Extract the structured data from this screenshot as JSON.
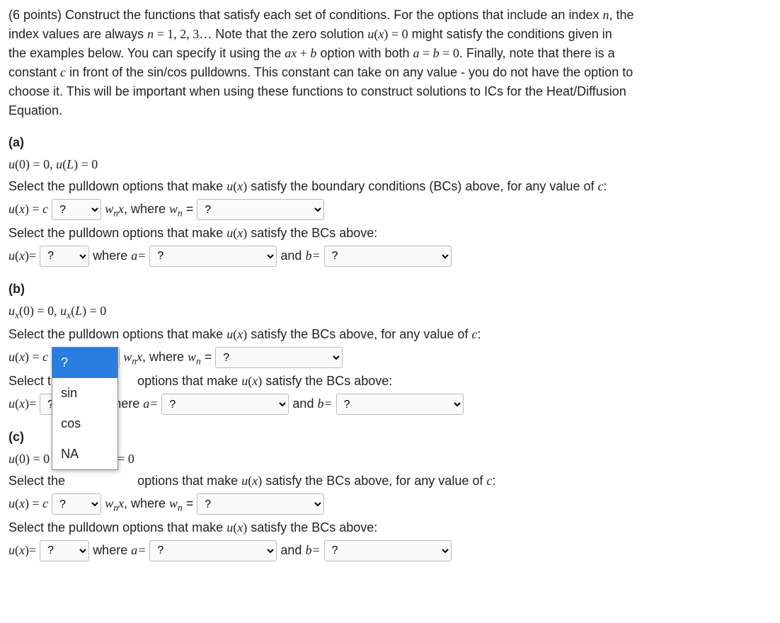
{
  "intro": {
    "line1_a": "(6 points) Construct the functions that satisfy each set of conditions. For the options that include an index ",
    "line1_b": ", the",
    "line2_a": "index values are always ",
    "line2_b": " Note that the zero solution ",
    "line2_c": " might satisfy the conditions given in",
    "line3_a": "the examples below. You can specify it using the ",
    "line3_b": " option with both ",
    "line3_c": ". Finally, note that there is a",
    "line4_a": "constant ",
    "line4_b": " in front of the sin/cos pulldowns. This constant can take on any value - you do not have the option to",
    "line5": "choose it. This will be important when using these functions to construct solutions to ICs for the Heat/Diffusion",
    "line6": "Equation.",
    "n_eq": "n = 1, 2, 3…",
    "ux0": "u(x) = 0",
    "axb": "ax + b",
    "ab0": "a = b = 0",
    "n": "n",
    "c": "c"
  },
  "common": {
    "select_any_c": "Select the pulldown options that make ",
    "satisfy_bc_anyc": " satisfy the boundary conditions (BCs) above, for any value of ",
    "satisfy_bc_anyc_short": " satisfy the BCs above, for any value of ",
    "select_bc": "Select the pulldown options that make ",
    "satisfy_bc": " satisfy the BCs above:",
    "uxeqc": "u(x) = c",
    "uxeq": "u(x)=",
    "ux": "u(x)",
    "wnx_where": ", where ",
    "wnx_eq": " = ",
    "where_a": "where ",
    "and_b": " and ",
    "a_eq": "a=",
    "b_eq": "b=",
    "colon": ":",
    "select_the": "Select the",
    "options_that_make": "options that make ",
    "here_a": "here ",
    "c": "c"
  },
  "parts": {
    "a": {
      "label": "(a)",
      "bc": "u(0) = 0, u(L) = 0"
    },
    "b": {
      "label": "(b)",
      "bc_html": "u_x(0) = 0, u_x(L) = 0"
    },
    "c": {
      "label": "(c)",
      "bc_left": "u(0) = 0",
      "bc_right": "= 0"
    }
  },
  "placeholders": {
    "q": "?"
  },
  "dropdown": {
    "items": [
      "?",
      "sin",
      "cos",
      "NA"
    ]
  }
}
